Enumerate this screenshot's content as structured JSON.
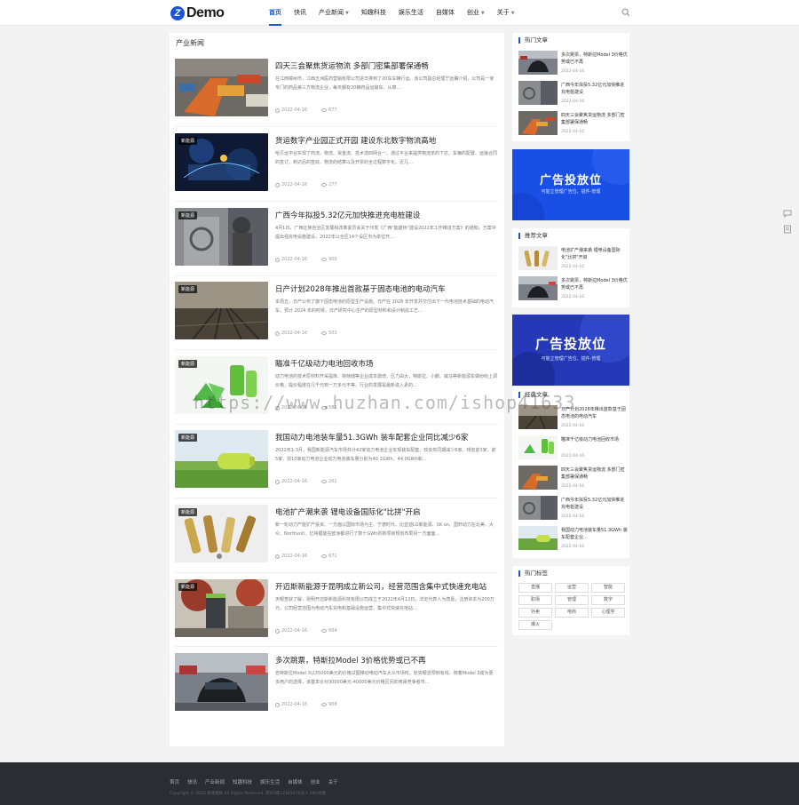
{
  "logo": {
    "text": "Demo"
  },
  "nav": [
    {
      "label": "首页",
      "active": true,
      "dropdown": false
    },
    {
      "label": "快讯",
      "active": false,
      "dropdown": false
    },
    {
      "label": "产业新闻",
      "active": false,
      "dropdown": true
    },
    {
      "label": "知趣科技",
      "active": false,
      "dropdown": false
    },
    {
      "label": "娱乐生活",
      "active": false,
      "dropdown": false
    },
    {
      "label": "自媒体",
      "active": false,
      "dropdown": false
    },
    {
      "label": "创业",
      "active": false,
      "dropdown": true
    },
    {
      "label": "关于",
      "active": false,
      "dropdown": true
    }
  ],
  "main": {
    "section_title": "产业新闻",
    "articles": [
      {
        "title": "四天三会聚焦货运物流 多部门密集部署保通畅",
        "desc": "在江西樟树市，江西五洲医药营销有限公司进日排到了20车车辆行运。该公司副总经理宁远确介绍，公司是一家专门的药品第三方物流企业，每天都有20辆药品运输车、从樟…",
        "date": "2022-04-16",
        "views": "677",
        "tag": ""
      },
      {
        "title": "货运数字产业园正式开园 建设东北数字物流高地",
        "desc": "哈贝运平台实现了商流、物流、资金流、技术流四网合一，通过平台来提供物流单的下达、车辆的配置、运输合同的签订、到达后的签收、物流的结算以及开票的全过程数字化。近几…",
        "date": "2022-04-16",
        "views": "277",
        "tag": "新能源"
      },
      {
        "title": "广西今年拟投5.32亿元加快推进充电桩建设",
        "desc": "4月1日，广西壮族自治区发展和改革委员会关于印发《广西\"能建桥\"建设2022年工作推进方案》的通知。方案中提出强充电设施建设，2022年以全区14个设区市为单位开…",
        "date": "2022-04-16",
        "views": "900",
        "tag": "新能源"
      },
      {
        "title": "日产计划2028年推出首款基于固态电池的电动汽车",
        "desc": "本周五，日产公布了旗下固态电池的原型生产设施。日产在 2028 年开发并交付出下一代电池技术基础的电动汽车。预计 2024 年的时候，日产研究中心生产的原型材料和设计制造工艺…",
        "date": "2022-04-16",
        "views": "503",
        "tag": "新能源"
      },
      {
        "title": "瞄准千亿级动力电池回收市场",
        "desc": "动力电池的技术原材料开采提炼、荷荷储等企业成本激增，压力由大，特斯拉、小鹏、威马等新能源车做纷纷上调价格，提价幅度在几千元到一万多元不等。行业的发展是最新进入素的…",
        "date": "2022-04-16",
        "views": "581",
        "tag": "新能源"
      },
      {
        "title": "我国动力电池装车量51.3GWh 装车配套企业同比减少6家",
        "desc": "2022年1-3月，我国新能源汽车市场共计42家动力电池企业实现装车配套，较去年同期减少6家。排名前3家、前5家、前10家动力电池企业动力电池装车量分别为40.1GWh、44.0GWh和…",
        "date": "2022-04-16",
        "views": "261",
        "tag": "新能源"
      },
      {
        "title": "电池扩产潮来袭 锂电设备国际化\"比拼\"开启",
        "desc": "新一轮动力产能扩产投资、一方面以国际市场为主、宁德时代、比亚迪LG新能源、SK on、国轩动力在北美、大众、Northvolt、亿纬锂能在欧洲都进行了数十GWh的新项目规划布局另一方面面…",
        "date": "2022-04-16",
        "views": "671",
        "tag": "新能源"
      },
      {
        "title": "开迈斯新能源于昆明成立新公司，经营范围含集中式快速充电站",
        "desc": "天眼查获了解，昆明开迈斯新能源科技有限公司成立于2022年4月12日，法定代表人为唐嘉，注册资本为200万元，公司经营范围为电动汽车充电和基础设施运营、集中式快速充电站…",
        "date": "2022-04-16",
        "views": "664",
        "tag": "新能源"
      },
      {
        "title": "多次跳票，特斯拉Model 3价格优势或已不再",
        "desc": "自特斯拉Model 3以35000美元的价格试图推动电动汽车大众市场时，愈突眼曾预到有线、随着Model 3成为更多用户的选择，该基本价对30000美元-40000美元价格区间的用来竞争者市…",
        "date": "2022-04-16",
        "views": "908",
        "tag": ""
      }
    ]
  },
  "hot": {
    "title": "热门文章",
    "items": [
      {
        "title": "多次跳票，特斯拉Model 3价格优势或已不再",
        "date": "2022-04-16"
      },
      {
        "title": "广西今年拟投5.32亿元加快推进充电桩建设",
        "date": "2022-04-16"
      },
      {
        "title": "四天三会聚焦货运物流 多部门密集部署保通畅",
        "date": "2022-04-16"
      }
    ]
  },
  "ad1": {
    "title": "广告投放位",
    "sub": "可能立管理广告位、插件-管理"
  },
  "recommend": {
    "title": "推荐文章",
    "items": [
      {
        "title": "电池扩产潮来袭 锂电设备国际化\"比拼\"开启",
        "date": "2022-04-16"
      },
      {
        "title": "多次跳票，特斯拉Model 3价格优势或已不再",
        "date": "2022-04-16"
      }
    ]
  },
  "ad2": {
    "title": "广告投放位",
    "sub": "可能立管理广告位、插件-管理"
  },
  "classic": {
    "title": "经典文章",
    "items": [
      {
        "title": "日产计划2028年推出首款基于固态电池的电动汽车",
        "date": "2022-04-16"
      },
      {
        "title": "瞄准千亿级动力电池回收市场",
        "date": "2022-04-16"
      },
      {
        "title": "四天三会聚焦货运物流 多部门密集部署保通畅",
        "date": "2022-04-16"
      },
      {
        "title": "广西今年拟投5.32亿元加快推进充电桩建设",
        "date": "2022-04-16"
      },
      {
        "title": "我国动力电池装车量51.3GWh 装车配套企业…",
        "date": "2022-04-16"
      }
    ]
  },
  "tags": {
    "title": "热门标签",
    "items": [
      "直播",
      "运营",
      "智能",
      "职场",
      "管理",
      "数字",
      "外卖",
      "电商",
      "心理学",
      "爆火"
    ]
  },
  "watermark": "https://www.huzhan.com/ishop41633",
  "footer": {
    "links": [
      "首页",
      "快讯",
      "产业新闻",
      "知趣科技",
      "娱乐生活",
      "自媒体",
      "创业",
      "关于"
    ],
    "copyright": "Copyright © 2022 新闻模板 All Rights Reserved. 苏ICP备12345678号-1 XML地图"
  }
}
